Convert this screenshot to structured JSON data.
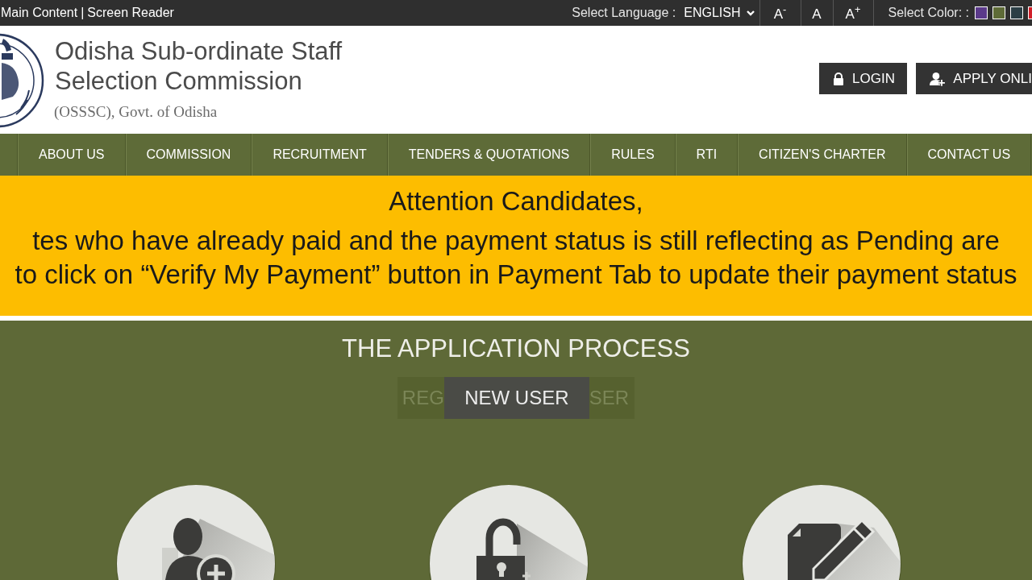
{
  "top_bar": {
    "links": [
      {
        "label": "Main Content"
      },
      {
        "label": "Screen Reader"
      }
    ],
    "separator": "|",
    "language_label": "Select Language :",
    "language": "ENGLISH",
    "font_size_buttons": [
      {
        "label": "A$^{-}$"
      },
      {
        "label": "A"
      },
      {
        "label": "A$^{+}$"
      }
    ],
    "color_label": "Select Color: :",
    "color_swatches": [
      {
        "color": "#5b3a8a"
      },
      {
        "color": "#5e6b37"
      },
      {
        "color": "#2c3e45"
      },
      {
        "color": "#d0202a"
      }
    ]
  },
  "header": {
    "title_lines": [
      "Odisha Sub-ordinate Staff",
      "Selection Commission"
    ],
    "subtitle": "(OSSSC), Govt. of Odisha",
    "buttons": [
      {
        "label": "LOGIN",
        "kind": "lock"
      },
      {
        "label": "APPLY ONLI",
        "kind": "user-plus"
      }
    ]
  },
  "nav": {
    "items": [
      {
        "label": "ABOUT US"
      },
      {
        "label": "COMMISSION"
      },
      {
        "label": "RECRUITMENT"
      },
      {
        "label": "TENDERS & QUOTATIONS"
      },
      {
        "label": "RULES"
      },
      {
        "label": "RTI"
      },
      {
        "label": "CITIZEN'S CHARTER"
      },
      {
        "label": "CONTACT US"
      }
    ]
  },
  "notice": {
    "heading": "Attention Candidates,",
    "lines": [
      "tes who have already paid and the payment status is still reflecting as Pending are",
      "to click on “Verify My Payment” button in Payment Tab to update their payment status"
    ]
  },
  "application_process": {
    "title": "THE APPLICATION PROCESS",
    "fading_tab": {
      "text_start": "REG",
      "text_end": "SER"
    },
    "active_tab": {
      "label": "NEW USER"
    },
    "steps": [
      {
        "kind": "user-plus"
      },
      {
        "kind": "unlock"
      },
      {
        "kind": "document-edit"
      }
    ]
  }
}
